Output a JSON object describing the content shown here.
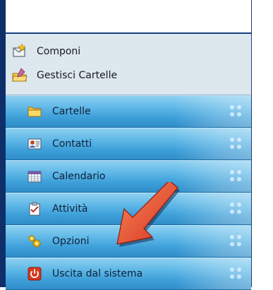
{
  "quick_actions": [
    {
      "label": "Componi",
      "icon": "compose-icon"
    },
    {
      "label": "Gestisci Cartelle",
      "icon": "manage-folders-icon"
    }
  ],
  "menu": [
    {
      "label": "Cartelle",
      "icon": "folder-icon"
    },
    {
      "label": "Contatti",
      "icon": "contacts-icon"
    },
    {
      "label": "Calendario",
      "icon": "calendar-icon"
    },
    {
      "label": "Attività",
      "icon": "tasks-icon"
    },
    {
      "label": "Opzioni",
      "icon": "options-icon"
    },
    {
      "label": "Uscita dal sistema",
      "icon": "logout-icon"
    }
  ],
  "colors": {
    "menu_blue": "#3d9fd9",
    "nav_dark": "#0e2f6a",
    "panel_light": "#dce7ee",
    "arrow_red": "#e8402a"
  },
  "annotation": {
    "icon": "pointer-arrow-icon"
  }
}
